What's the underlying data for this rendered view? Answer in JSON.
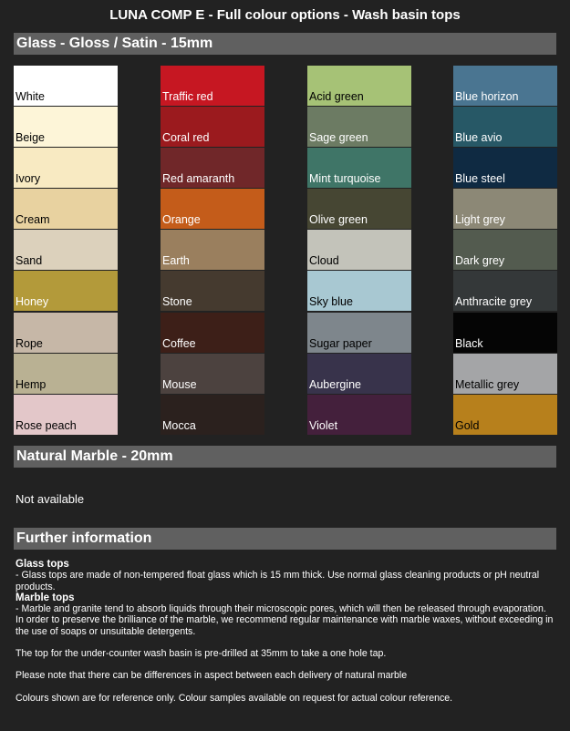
{
  "title": "LUNA COMP E - Full colour options - Wash basin tops",
  "glass_section": "Glass - Gloss / Satin - 15mm",
  "marble_section": "Natural Marble - 20mm",
  "marble_status": "Not available",
  "further_section": "Further information",
  "columns": [
    [
      {
        "name": "White",
        "color": "#ffffff",
        "text": "#000000"
      },
      {
        "name": "Beige",
        "color": "#fdf5d8",
        "text": "#000000"
      },
      {
        "name": "Ivory",
        "color": "#f8eac2",
        "text": "#000000"
      },
      {
        "name": "Cream",
        "color": "#e8d2a0",
        "text": "#000000"
      },
      {
        "name": "Sand",
        "color": "#dcd1bc",
        "text": "#000000"
      },
      {
        "name": "Honey",
        "color": "#b39a3a",
        "text": "#ffffff"
      },
      {
        "name": "Rope",
        "color": "#c6b7a7",
        "text": "#000000"
      },
      {
        "name": "Hemp",
        "color": "#b9b193",
        "text": "#000000"
      },
      {
        "name": "Rose peach",
        "color": "#e3c7c9",
        "text": "#000000"
      }
    ],
    [
      {
        "name": "Traffic red",
        "color": "#c61722",
        "text": "#ffffff"
      },
      {
        "name": "Coral red",
        "color": "#9b1a1e",
        "text": "#ffffff"
      },
      {
        "name": "Red amaranth",
        "color": "#702729",
        "text": "#ffffff"
      },
      {
        "name": "Orange",
        "color": "#c45c1a",
        "text": "#ffffff"
      },
      {
        "name": "Earth",
        "color": "#9a7f5e",
        "text": "#ffffff"
      },
      {
        "name": "Stone",
        "color": "#453a2f",
        "text": "#ffffff"
      },
      {
        "name": "Coffee",
        "color": "#3d1f18",
        "text": "#ffffff"
      },
      {
        "name": "Mouse",
        "color": "#4c423f",
        "text": "#ffffff"
      },
      {
        "name": "Mocca",
        "color": "#2b211e",
        "text": "#ffffff"
      }
    ],
    [
      {
        "name": "Acid green",
        "color": "#a6c276",
        "text": "#000000"
      },
      {
        "name": "Sage green",
        "color": "#6c7b63",
        "text": "#ffffff"
      },
      {
        "name": "Mint turquoise",
        "color": "#3f7567",
        "text": "#ffffff"
      },
      {
        "name": "Olive green",
        "color": "#464633",
        "text": "#ffffff"
      },
      {
        "name": "Cloud",
        "color": "#c3c3ba",
        "text": "#000000"
      },
      {
        "name": "Sky blue",
        "color": "#a8c8d2",
        "text": "#000000"
      },
      {
        "name": "Sugar paper",
        "color": "#7e868c",
        "text": "#000000"
      },
      {
        "name": "Aubergine",
        "color": "#38334b",
        "text": "#ffffff"
      },
      {
        "name": "Violet",
        "color": "#44203c",
        "text": "#ffffff"
      }
    ],
    [
      {
        "name": "Blue horizon",
        "color": "#4a7591",
        "text": "#ffffff"
      },
      {
        "name": "Blue avio",
        "color": "#275866",
        "text": "#ffffff"
      },
      {
        "name": "Blue steel",
        "color": "#0f2a42",
        "text": "#ffffff"
      },
      {
        "name": "Light grey",
        "color": "#8c8876",
        "text": "#ffffff"
      },
      {
        "name": "Dark grey",
        "color": "#535b4f",
        "text": "#ffffff"
      },
      {
        "name": "Anthracite grey",
        "color": "#343839",
        "text": "#ffffff"
      },
      {
        "name": "Black",
        "color": "#050505",
        "text": "#ffffff"
      },
      {
        "name": "Metallic grey",
        "color": "#a4a5a7",
        "text": "#000000"
      },
      {
        "name": "Gold",
        "color": "#b7801c",
        "text": "#000000"
      }
    ]
  ],
  "info": {
    "glass_heading": "Glass tops",
    "glass_text": "- Glass tops are made of non-tempered float glass which is 15 mm thick. Use normal glass cleaning products or pH neutral products.",
    "marble_heading": "Marble tops",
    "marble_text": "- Marble and granite tend to absorb liquids through their microscopic pores, which will then be released through evaporation. In order to preserve the brilliance of the marble, we recommend regular maintenance with marble waxes, without exceeding in the use of soaps or unsuitable detergents.",
    "note1": "The top for the under-counter wash basin is pre-drilled at 35mm to take a one hole tap.",
    "note2": "Please note that there can be differences in aspect between each delivery of natural marble",
    "note3": "Colours shown are for reference only. Colour samples available on request for actual colour reference."
  }
}
